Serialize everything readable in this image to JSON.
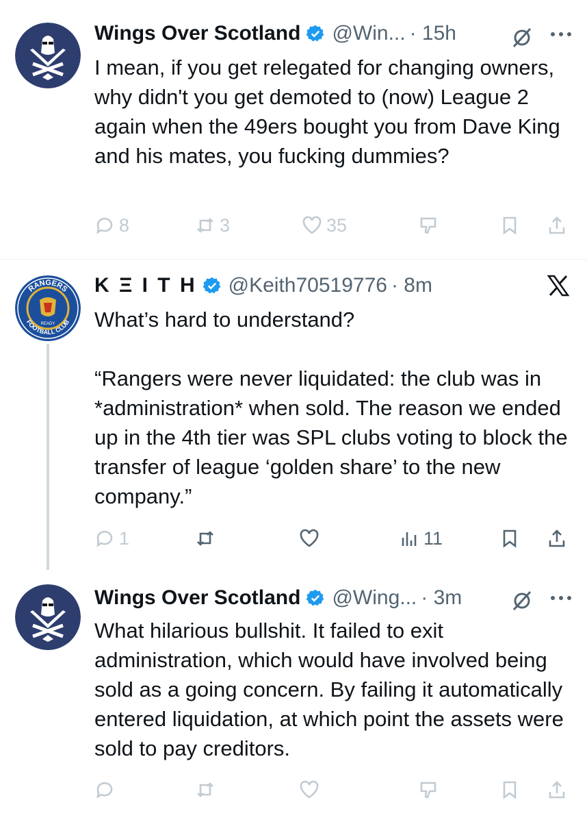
{
  "tweets": [
    {
      "name": "Wings Over Scotland",
      "handle": "@Win...",
      "time": "· 15h",
      "text": "I mean, if you get relegated for changing owners, why didn't you get demoted to (now) League 2 again when the 49ers bought you from Dave King and his mates, you fucking dummies?",
      "replies": "8",
      "retweets": "3",
      "likes": "35"
    },
    {
      "name": "K Ξ I T H",
      "handle": "@Keith70519776",
      "time": "· 8m",
      "text": "What’s hard to understand?\n\n“Rangers were never liquidated: the club was in *administration* when sold. The reason we ended up in the 4th tier was SPL clubs voting to block the transfer of league ‘golden share’ to the new company.”",
      "replies": "1",
      "views": "11"
    },
    {
      "name": "Wings Over Scotland",
      "handle": "@Wing...",
      "time": "· 3m",
      "text": "What hilarious bullshit. It failed to exit administration, which would have involved being sold as a going concern. By failing it automatically entered liquidation, at which point the assets were sold to pay creditors."
    }
  ],
  "badge_logo": {
    "top": "RANGERS",
    "bottom": "FOOTBALL CLUB",
    "motto": "READY"
  },
  "colors": {
    "verified": "#1d9bf0",
    "muted": "#536471",
    "faint": "#c2cbd2",
    "wos_navy": "#2d3e6e",
    "rangers_blue": "#1b4f9c"
  }
}
